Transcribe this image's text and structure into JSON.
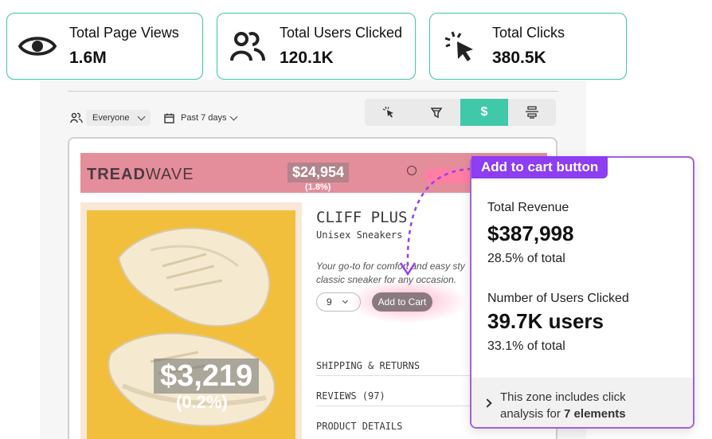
{
  "stats": [
    {
      "label": "Total Page Views",
      "value": "1.6M",
      "icon": "eye-icon"
    },
    {
      "label": "Total Users Clicked",
      "value": "120.1K",
      "icon": "users-icon"
    },
    {
      "label": "Total Clicks",
      "value": "380.5K",
      "icon": "cursor-click-icon"
    }
  ],
  "filters": {
    "audience": "Everyone",
    "period": "Past 7 days"
  },
  "toolbar": {
    "revenue_symbol": "$"
  },
  "store": {
    "logo_a": "TREAD",
    "logo_b": "WAVE",
    "header_revenue": "$24,954",
    "header_revenue_pct": "(1.8%)",
    "image_revenue": "$3,219",
    "image_revenue_pct": "(0.2%)",
    "product_title": "CLIFF PLUS",
    "product_subtitle": "Unisex Sneakers",
    "description_line1": "Your go-to for comfort and easy sty",
    "description_line2": "classic sneaker for any occasion.",
    "quantity": "9",
    "add_to_cart": "Add to Cart",
    "accordions": [
      "SHIPPING & RETURNS",
      "REVIEWS (97)",
      "PRODUCT DETAILS"
    ]
  },
  "tooltip": {
    "tag": "Add to cart button",
    "revenue_label": "Total Revenue",
    "revenue_value": "$387,998",
    "revenue_pct": "28.5% of total",
    "users_label": "Number of Users Clicked",
    "users_value": "39.7K users",
    "users_pct": "33.1% of total",
    "footer_text": "This zone includes click",
    "footer_text2": "analysis for ",
    "footer_bold": "7 elements"
  },
  "colors": {
    "accent": "#3fc9a8",
    "tooltip_purple": "#8d3df2",
    "store_header": "#e48e9b",
    "product_bg": "#f2bf3c"
  }
}
